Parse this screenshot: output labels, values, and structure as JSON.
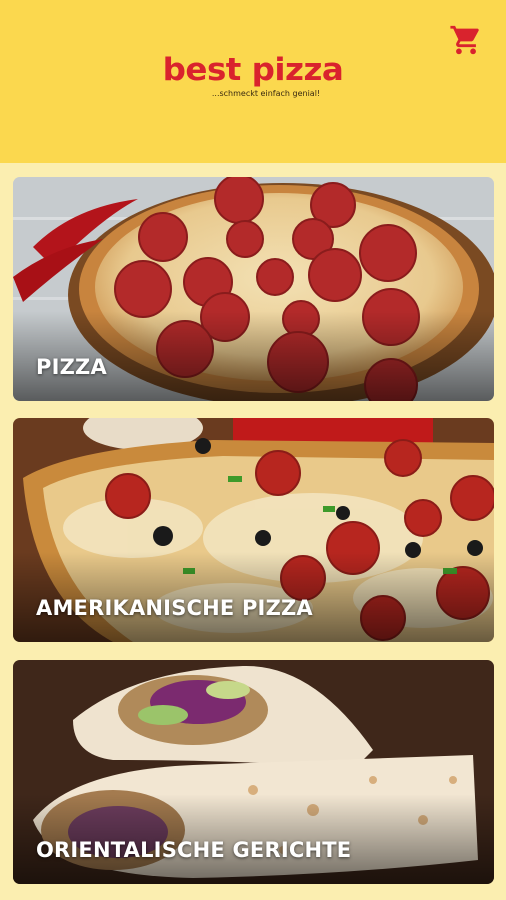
{
  "header": {
    "brand": "best pizza",
    "tagline": "...schmeckt einfach genial!",
    "cart_icon": "shopping-cart-icon",
    "brand_color": "#d9232d",
    "background": "#fbd84e"
  },
  "categories": [
    {
      "label": "PIZZA",
      "image": "pepperoni-pizza-photo"
    },
    {
      "label": "AMERIKANISCHE PIZZA",
      "image": "american-pizza-photo"
    },
    {
      "label": "ORIENTALISCHE GERICHTE",
      "image": "wrap-photo"
    }
  ],
  "colors": {
    "page_background": "#fbeeb0",
    "label_text": "#ffffff"
  }
}
